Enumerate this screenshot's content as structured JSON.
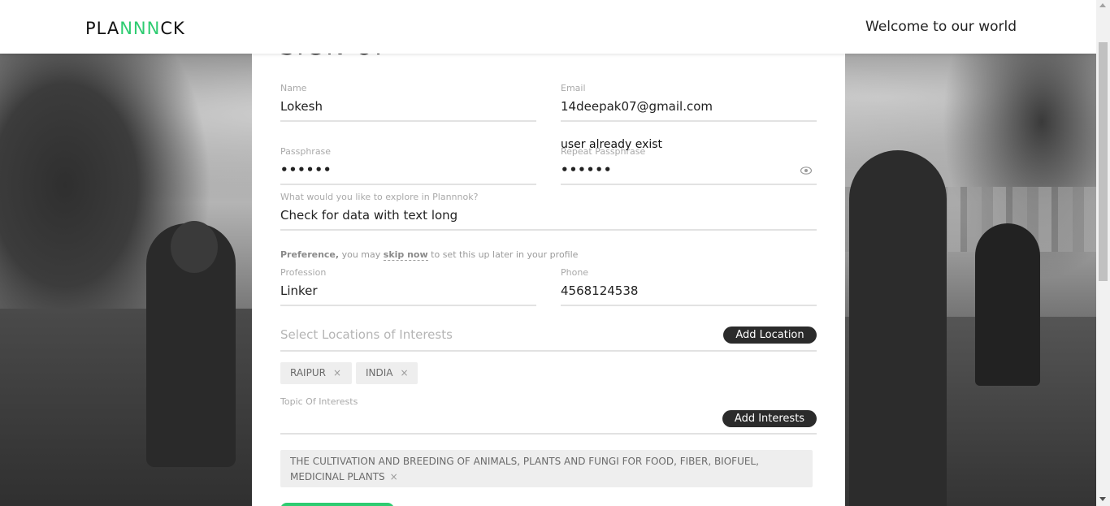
{
  "header": {
    "logo_prefix": "PLA",
    "logo_highlight": "NNN",
    "logo_suffix": "CK",
    "welcome_text": "Welcome to our world"
  },
  "form": {
    "heading": "SIGN UP",
    "name": {
      "label": "Name",
      "value": "Lokesh"
    },
    "email": {
      "label": "Email",
      "value": "14deepak07@gmail.com"
    },
    "passphrase": {
      "label": "Passphrase",
      "value": "••••••"
    },
    "repeat_passphrase": {
      "label": "Repeat Passphrase",
      "value": "••••••"
    },
    "error_text": "user already exist",
    "explore": {
      "label": "What would you like to explore in Plannnok?",
      "value": "Check for data with text long"
    },
    "preference": {
      "bold": "Preference,",
      "text1": "you may",
      "skip": "skip now",
      "text2": "to set this up later in your profile"
    },
    "profession": {
      "label": "Profession",
      "value": "Linker"
    },
    "phone": {
      "label": "Phone",
      "value": "4568124538"
    },
    "locations": {
      "placeholder": "Select Locations of Interests",
      "button": "Add Location",
      "chips": [
        "RAIPUR",
        "INDIA"
      ]
    },
    "topics": {
      "label": "Topic Of Interests",
      "button": "Add Interests",
      "chips": [
        "THE CULTIVATION AND BREEDING OF ANIMALS, PLANTS AND FUNGI FOR FOOD, FIBER, BIOFUEL, MEDICINAL PLANTS"
      ]
    },
    "chip_close": "×"
  },
  "colors": {
    "accent": "#2ecc71",
    "dark_button": "#2b2b2b",
    "chip_bg": "#eeeeee"
  }
}
